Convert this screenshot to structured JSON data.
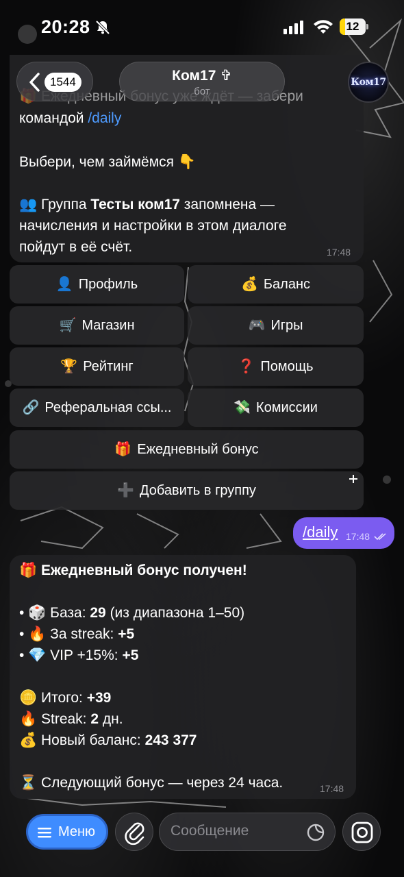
{
  "status_bar": {
    "time": "20:28",
    "battery": "12"
  },
  "header": {
    "back_count": "1544",
    "title": "Ком17 ✞",
    "subtitle": "бот",
    "avatar_text": "Ком17"
  },
  "message_top": {
    "lines": {
      "l1_text": "Ежедневный бонус уже ждёт — забери",
      "l2_prefix": "командой ",
      "l2_link": "/daily",
      "l3": "Выбери, чем займёмся 👇",
      "l4_prefix": "👥 Группа ",
      "l4_bold": "Тесты ком17",
      "l4_suffix": " запомнена —",
      "l5": "начисления и настройки в этом диалоге",
      "l6": "пойдут в её счёт."
    },
    "time": "17:48"
  },
  "keyboard": {
    "rows": [
      [
        {
          "emoji": "👤",
          "label": "Профиль"
        },
        {
          "emoji": "💰",
          "label": "Баланс"
        }
      ],
      [
        {
          "emoji": "🛒",
          "label": "Магазин"
        },
        {
          "emoji": "🎮",
          "label": "Игры"
        }
      ],
      [
        {
          "emoji": "🏆",
          "label": "Рейтинг"
        },
        {
          "emoji": "❓",
          "label": "Помощь"
        }
      ],
      [
        {
          "emoji": "🔗",
          "label": "Реферальная ссы..."
        },
        {
          "emoji": "💸",
          "label": "Комиссии"
        }
      ],
      [
        {
          "emoji": "🎁",
          "label": "Ежедневный бонус"
        }
      ],
      [
        {
          "emoji": "➕",
          "label": "Добавить в группу"
        }
      ]
    ]
  },
  "outgoing": {
    "text": "/daily",
    "time": "17:48"
  },
  "bonus_message": {
    "title_emoji": "🎁",
    "title": "Ежедневный бонус получен!",
    "base": {
      "prefix": "• 🎲 База: ",
      "bold": "29",
      "suffix": " (из диапазона 1–50)"
    },
    "streak_bonus": {
      "prefix": "• 🔥 За streak: ",
      "bold": "+5"
    },
    "vip": {
      "prefix": "• 💎 VIP +15%: ",
      "bold": "+5"
    },
    "total": {
      "prefix": "🪙 Итого: ",
      "bold": "+39"
    },
    "streak": {
      "prefix": "🔥 Streak: ",
      "bold": "2",
      "suffix": " дн."
    },
    "balance": {
      "prefix": "💰 Новый баланс: ",
      "bold": "243 377"
    },
    "next": "⏳ Следующий бонус — через 24 часа.",
    "time": "17:48"
  },
  "bottom_bar": {
    "menu_label": "Меню",
    "input_placeholder": "Сообщение"
  },
  "colors": {
    "accent_blue": "#3f8cff",
    "outgoing_bubble": "#7b5cf0",
    "link": "#4e9bff"
  }
}
